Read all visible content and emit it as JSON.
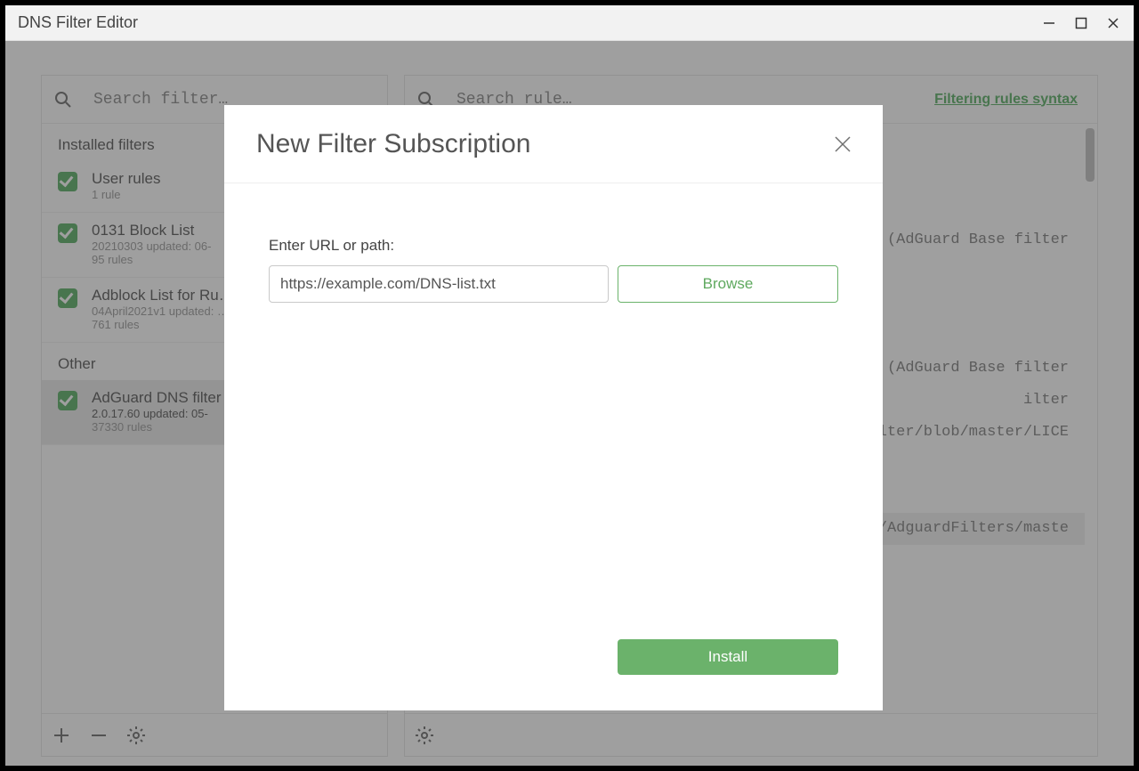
{
  "window": {
    "title": "DNS Filter Editor"
  },
  "left": {
    "search_placeholder": "Search filter…",
    "section_installed": "Installed filters",
    "section_other": "Other",
    "filters_installed": [
      {
        "name": "User rules",
        "meta1": "1 rule",
        "meta2": ""
      },
      {
        "name": "0131 Block List",
        "meta1": "20210303 updated: 06-",
        "meta2": "95 rules"
      },
      {
        "name": "Adblock List for Ru…",
        "meta1": "04April2021v1 updated: …",
        "meta2": "761 rules"
      }
    ],
    "filters_other": [
      {
        "name": "AdGuard DNS filter",
        "meta1": "2.0.17.60 updated: 05-",
        "meta2": "37330 rules"
      }
    ]
  },
  "right": {
    "search_placeholder": "Search rule…",
    "syntax_link_label": "Filtering rules syntax",
    "rules_lines": [
      "",
      "(AdGuard Base filter",
      "",
      "",
      "",
      "(AdGuard Base filter",
      "ilter",
      "lter/blob/master/LICE",
      "",
      "",
      "/AdguardFilters/maste"
    ],
    "highlight_index": 10
  },
  "modal": {
    "title": "New Filter Subscription",
    "label": "Enter URL or path:",
    "url_value": "https://example.com/DNS-list.txt",
    "browse_label": "Browse",
    "install_label": "Install"
  },
  "icons": {
    "search": "search-icon",
    "plus": "plus-icon",
    "minus": "minus-icon",
    "gear": "gear-icon",
    "close": "close-icon",
    "minimize": "minimize-icon",
    "maximize": "maximize-icon",
    "x": "x-icon"
  }
}
